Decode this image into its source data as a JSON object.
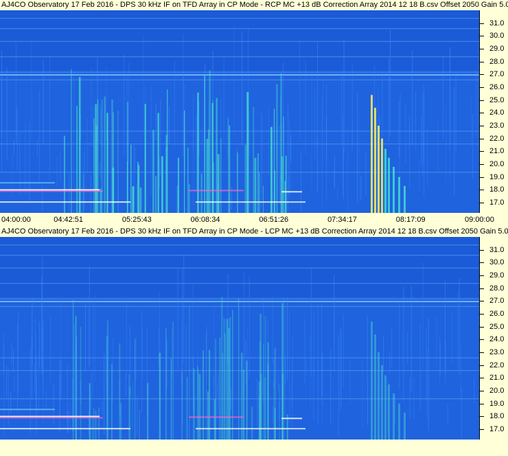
{
  "chart_data": [
    {
      "type": "heatmap",
      "title": "AJ4CO Observatory 17 Feb 2016 - DPS 30 kHz IF on TFD Array in CP Mode - RCP  MC +13 dB  Correction Array 2014 12 18 B.csv  Offset 2050  Gain 5.0",
      "xlabel": "",
      "ylabel": "",
      "x_tick_labels": [
        "04:00:00",
        "04:42:51",
        "05:25:43",
        "06:08:34",
        "06:51:26",
        "07:34:17",
        "08:17:09",
        "09:00:00"
      ],
      "y_tick_labels": [
        "31.0",
        "30.0",
        "29.0",
        "28.0",
        "27.0",
        "26.0",
        "25.0",
        "24.0",
        "23.0",
        "22.0",
        "21.0",
        "20.0",
        "19.0",
        "18.0",
        "17.0"
      ],
      "ylim": [
        16.2,
        32.0
      ],
      "colors": {
        "background": "#1f63de",
        "bright": "#ffffff",
        "hot": "#ffee55",
        "mid": "#44d8d0"
      }
    },
    {
      "type": "heatmap",
      "title": "AJ4CO Observatory 17 Feb 2016 - DPS 30 kHz IF on TFD Array in CP Mode - LCP  MC +13 dB  Correction Array 2014 12 18 B.csv  Offset 2050  Gain 5.0",
      "xlabel": "",
      "ylabel": "",
      "x_tick_labels": [],
      "y_tick_labels": [
        "31.0",
        "30.0",
        "29.0",
        "28.0",
        "27.0",
        "26.0",
        "25.0",
        "24.0",
        "23.0",
        "22.0",
        "21.0",
        "20.0",
        "19.0",
        "18.0",
        "17.0"
      ],
      "ylim": [
        16.2,
        32.0
      ],
      "colors": {
        "background": "#1f63de",
        "bright": "#ffffff",
        "hot": "#ffee55",
        "mid": "#44d8d0"
      }
    }
  ]
}
